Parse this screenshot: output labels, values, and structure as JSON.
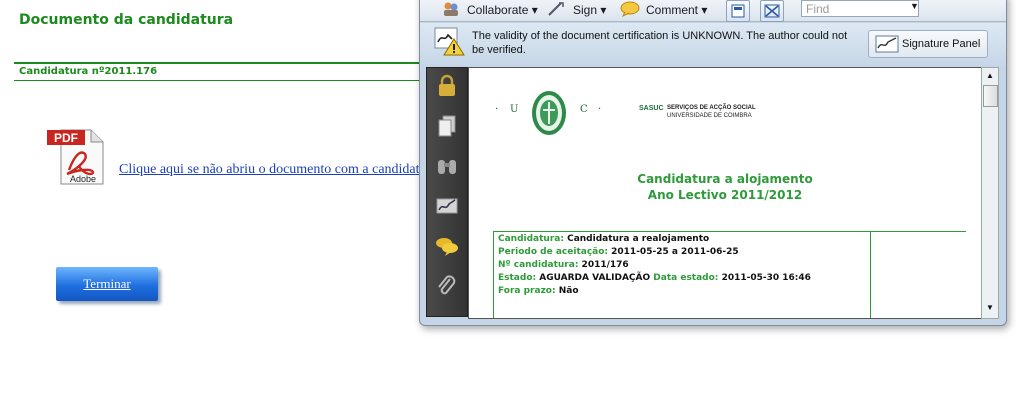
{
  "page": {
    "title": "Documento da candidatura",
    "candidatura_number": "Candidatura nº2011.176",
    "pdf_link": "Clique aqui se não abriu o documento com a candidatura",
    "terminar_button": "Terminar",
    "pdf_icon_label": "PDF",
    "pdf_icon_brand": "Adobe"
  },
  "viewer": {
    "toolbar": {
      "collaborate": "Collaborate",
      "sign": "Sign",
      "comment": "Comment",
      "find_placeholder": "Find"
    },
    "cert_message": "The validity of the document certification is UNKNOWN. The author could not be verified.",
    "signature_panel_button": "Signature Panel",
    "nav_icons": [
      "lock-icon",
      "pages-icon",
      "binoculars-icon",
      "signature-icon",
      "comments-icon",
      "attachment-icon"
    ],
    "document": {
      "header_letter_u": "U",
      "header_letter_c": "C",
      "sasuc": "SASUC",
      "servicos": "SERVIÇOS DE ACÇÃO SOCIAL",
      "universidade": "UNIVERSIDADE DE COIMBRA",
      "title_line1": "Candidatura  a alojamento",
      "title_line2": "Ano Lectivo 2011/2012",
      "fields": [
        {
          "key": "Candidatura:",
          "value": " Candidatura a realojamento"
        },
        {
          "key": "Periodo de aceitação:",
          "value": " 2011-05-25 a 2011-06-25"
        },
        {
          "key": "Nº candidatura:",
          "value": " 2011/176"
        },
        {
          "key": "Estado:",
          "value": " AGUARDA VALIDAÇÃO"
        },
        {
          "key": "Fora prazo:",
          "value": " Não"
        }
      ],
      "estado_date_key": "Data estado:",
      "estado_date_value": "2011-05-30 16:46"
    }
  },
  "colors": {
    "brand_green": "#1c8a1c",
    "link_blue": "#1a3fb8",
    "button_blue": "#1f6fe0"
  }
}
